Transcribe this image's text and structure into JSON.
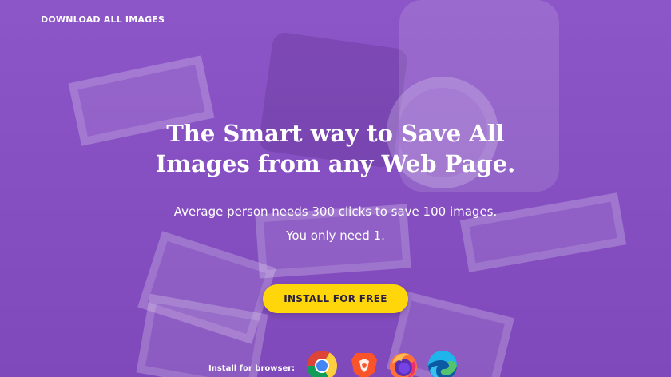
{
  "nav": {
    "download_all_images": "DOWNLOAD ALL IMAGES"
  },
  "hero": {
    "headline_line1": "The Smart way to Save All",
    "headline_line2": "Images from any Web Page.",
    "subtext_line1": "Average person needs 300 clicks to save 100 images.",
    "subtext_line2": "You only need 1.",
    "cta_label": "INSTALL FOR FREE"
  },
  "browsers": {
    "label": "Install for browser:",
    "items": [
      {
        "name": "chrome-icon"
      },
      {
        "name": "brave-icon"
      },
      {
        "name": "firefox-icon"
      },
      {
        "name": "edge-icon"
      }
    ]
  },
  "colors": {
    "background": "#8a52c4",
    "cta": "#ffd60a",
    "cta_text": "#2a2140",
    "text": "#ffffff"
  }
}
